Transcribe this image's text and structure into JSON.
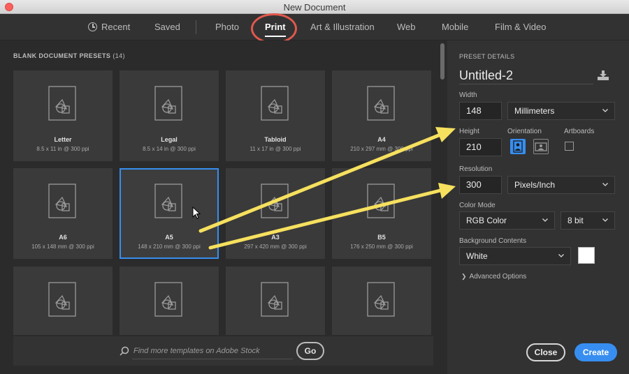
{
  "window": {
    "title": "New Document"
  },
  "tabs": [
    {
      "label": "Recent",
      "icon": "clock-icon"
    },
    {
      "label": "Saved"
    },
    {
      "label": "Photo"
    },
    {
      "label": "Print",
      "active": true
    },
    {
      "label": "Art & Illustration"
    },
    {
      "label": "Web"
    },
    {
      "label": "Mobile"
    },
    {
      "label": "Film & Video"
    }
  ],
  "presets": {
    "heading": "BLANK DOCUMENT PRESETS",
    "count": "(14)",
    "items": [
      {
        "name": "Letter",
        "dims": "8.5 x 11 in @ 300 ppi"
      },
      {
        "name": "Legal",
        "dims": "8.5 x 14 in @ 300 ppi"
      },
      {
        "name": "Tabloid",
        "dims": "11 x 17 in @ 300 ppi"
      },
      {
        "name": "A4",
        "dims": "210 x 297 mm @ 300 ppi"
      },
      {
        "name": "A6",
        "dims": "105 x 148 mm @ 300 ppi"
      },
      {
        "name": "A5",
        "dims": "148 x 210 mm @ 300 ppi",
        "selected": true
      },
      {
        "name": "A3",
        "dims": "297 x 420 mm @ 300 ppi"
      },
      {
        "name": "B5",
        "dims": "176 x 250 mm @ 300 ppi"
      }
    ]
  },
  "search": {
    "placeholder": "Find more templates on Adobe Stock",
    "go_label": "Go"
  },
  "details": {
    "heading": "PRESET DETAILS",
    "doc_name": "Untitled-2",
    "width_label": "Width",
    "width_value": "148",
    "units": "Millimeters",
    "height_label": "Height",
    "height_value": "210",
    "orientation_label": "Orientation",
    "orientation_value": "portrait",
    "artboards_label": "Artboards",
    "artboards_checked": false,
    "resolution_label": "Resolution",
    "resolution_value": "300",
    "resolution_units": "Pixels/Inch",
    "color_mode_label": "Color Mode",
    "color_mode": "RGB Color",
    "bit_depth": "8 bit",
    "background_label": "Background Contents",
    "background": "White",
    "background_color": "#ffffff",
    "advanced_label": "Advanced Options",
    "close_label": "Close",
    "create_label": "Create"
  },
  "colors": {
    "accent": "#378ef0",
    "annotation_arrow": "#f6e05e",
    "annotation_ring": "#e0584c"
  }
}
